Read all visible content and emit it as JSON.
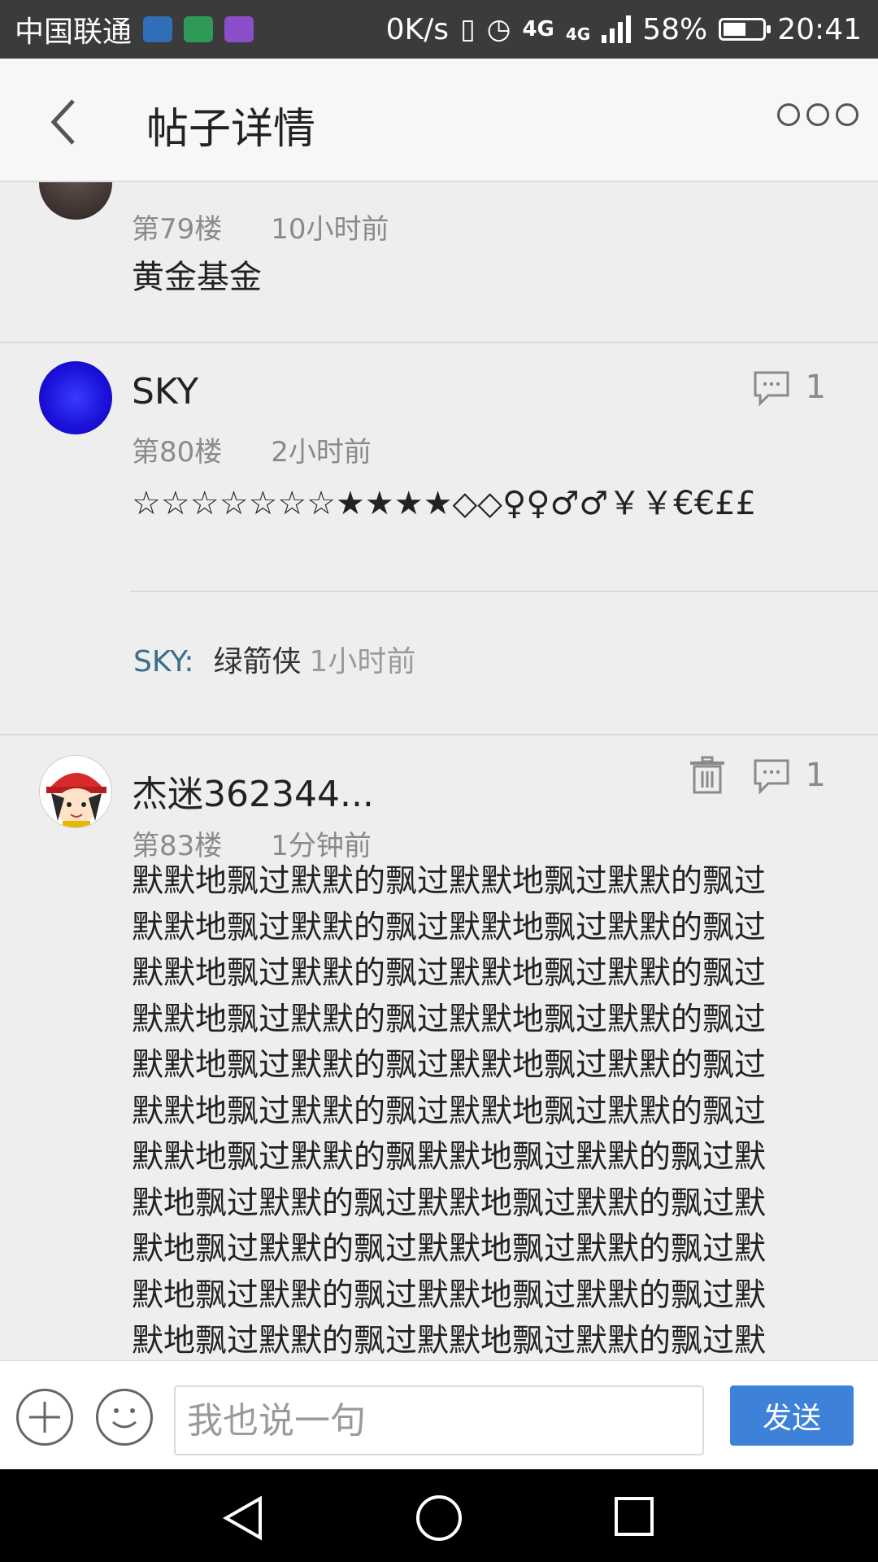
{
  "status_bar": {
    "carrier": "中国联通",
    "net_speed": "0K/s",
    "network": "4G",
    "network2": "4G",
    "battery_pct": "58%",
    "battery_level": 0.58,
    "time": "20:41"
  },
  "header": {
    "title": "帖子详情"
  },
  "posts": [
    {
      "floor": "第79楼",
      "time": "10小时前",
      "content": "黄金基金"
    },
    {
      "user": "SKY",
      "floor": "第80楼",
      "time": "2小时前",
      "content": "☆☆☆☆☆☆☆★★★★◇◇♀♀♂♂￥￥€€££",
      "reply_count": "1",
      "sub_reply": {
        "author": "SKY:",
        "text": "绿箭侠",
        "time": "1小时前"
      }
    },
    {
      "user": "杰迷362344...",
      "floor": "第83楼",
      "time": "1分钟前",
      "reply_count": "1",
      "content_lines": [
        "默默地飘过默默的飘过默默地飘过默默的飘过",
        "默默地飘过默默的飘过默默地飘过默默的飘过",
        "默默地飘过默默的飘过默默地飘过默默的飘过",
        "默默地飘过默默的飘过默默地飘过默默的飘过",
        "默默地飘过默默的飘过默默地飘过默默的飘过",
        "默默地飘过默默的飘过默默地飘过默默的飘过",
        "默默地飘过默默的飘默默地飘过默默的飘过默",
        "默地飘过默默的飘过默默地飘过默默的飘过默",
        "默地飘过默默的飘过默默地飘过默默的飘过默",
        "默地飘过默默的飘过默默地飘过默默的飘过默",
        "默地飘过默默的飘过默默地飘过默默的飘过默"
      ]
    }
  ],
  "input_bar": {
    "placeholder": "我也说一句",
    "send_label": "发送"
  },
  "colors": {
    "accent": "#3d82d8",
    "sub_reply_author": "#3a6e8a",
    "status_bar_bg": "#3b3b3b"
  }
}
